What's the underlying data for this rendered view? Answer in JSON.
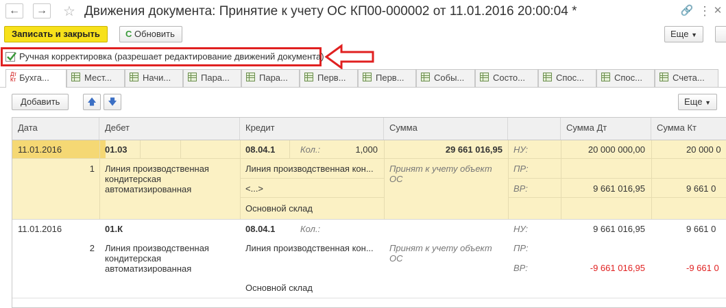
{
  "window": {
    "title": "Движения документа: Принятие к учету ОС КП00-000002 от 11.01.2016 20:00:04 *"
  },
  "toolbar": {
    "save_close": "Записать и закрыть",
    "refresh": "Обновить",
    "more": "Еще"
  },
  "manual": {
    "label": "Ручная корректировка (разрешает редактирование движений документа)",
    "checked": true
  },
  "tabs": [
    {
      "label": "Бухга..."
    },
    {
      "label": "Мест..."
    },
    {
      "label": "Начи..."
    },
    {
      "label": "Пара..."
    },
    {
      "label": "Пара..."
    },
    {
      "label": "Перв..."
    },
    {
      "label": "Перв..."
    },
    {
      "label": "Собы..."
    },
    {
      "label": "Состо..."
    },
    {
      "label": "Спос..."
    },
    {
      "label": "Спос..."
    },
    {
      "label": "Счета..."
    }
  ],
  "tabbar": {
    "add": "Добавить",
    "more": "Еще"
  },
  "columns": {
    "date": "Дата",
    "debet": "Дебет",
    "credit": "Кредит",
    "sum": "Сумма",
    "sum_dt": "Сумма Дт",
    "sum_kt": "Сумма Кт"
  },
  "rows": [
    {
      "date": "11.01.2016",
      "num": "1",
      "debet_account": "01.03",
      "debet_sub1": "Линия производственная кондитерская автоматизированная",
      "credit_account": "08.04.1",
      "qty_label": "Кол.:",
      "qty_value": "1,000",
      "credit_sub1": "Линия производственная кон...",
      "credit_sub2": "<...>",
      "credit_sub3": "Основной склад",
      "sum": "29 661 016,95",
      "content": "Принят к учету объект ОС",
      "nu_label": "НУ:",
      "pr_label": "ПР:",
      "vr_label": "ВР:",
      "nu_dt": "20 000 000,00",
      "nu_kt": "20 000 0",
      "vr_dt": "9 661 016,95",
      "vr_kt": "9 661 0"
    },
    {
      "date": "11.01.2016",
      "num": "2",
      "debet_account": "01.К",
      "debet_sub1": "Линия производственная кондитерская автоматизированная",
      "credit_account": "08.04.1",
      "qty_label": "Кол.:",
      "credit_sub1": "Линия производственная кон...",
      "credit_sub3": "Основной склад",
      "content": "Принят к учету объект ОС",
      "nu_label": "НУ:",
      "pr_label": "ПР:",
      "vr_label": "ВР:",
      "nu_dt": "9 661 016,95",
      "nu_kt": "9 661 0",
      "vr_dt": "-9 661 016,95",
      "vr_kt": "-9 661 0"
    }
  ]
}
